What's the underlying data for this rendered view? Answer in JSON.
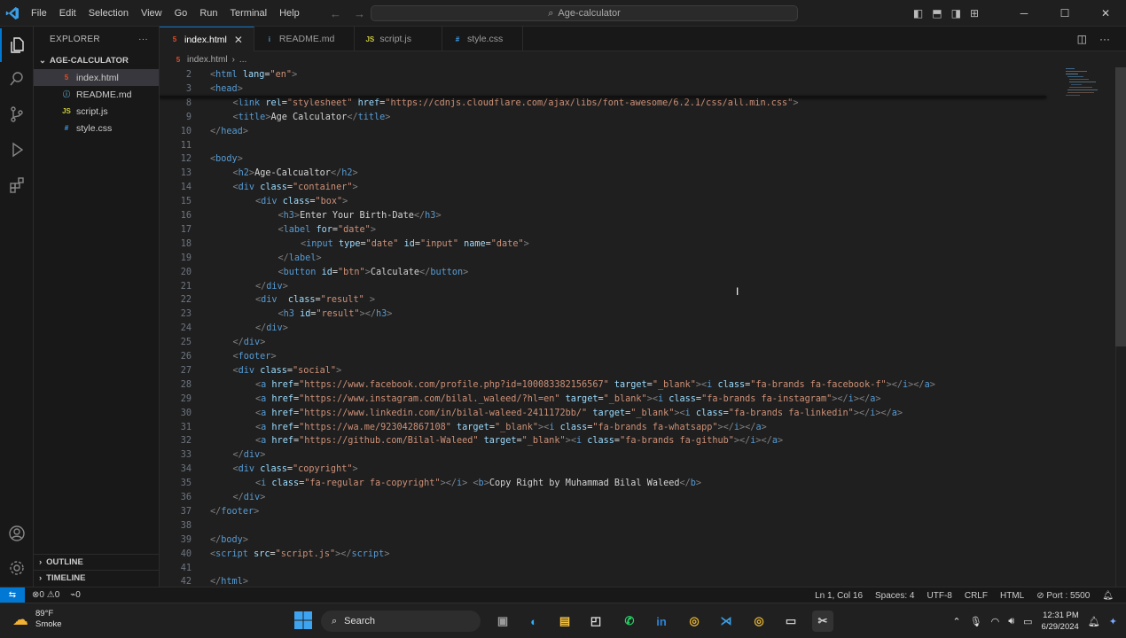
{
  "titlebar": {
    "menu": [
      "File",
      "Edit",
      "Selection",
      "View",
      "Go",
      "Run",
      "Terminal",
      "Help"
    ],
    "search_text": "Age-calculator"
  },
  "sidebar": {
    "title": "EXPLORER",
    "folder": "AGE-CALCULATOR",
    "files": [
      {
        "name": "index.html",
        "icon": "html-file-icon"
      },
      {
        "name": "README.md",
        "icon": "markdown-file-icon"
      },
      {
        "name": "script.js",
        "icon": "js-file-icon"
      },
      {
        "name": "style.css",
        "icon": "css-file-icon"
      }
    ],
    "outline": "OUTLINE",
    "timeline": "TIMELINE"
  },
  "tabs": [
    {
      "label": "index.html",
      "badge": "5"
    },
    {
      "label": "README.md",
      "badge": "i"
    },
    {
      "label": "script.js",
      "badge": "JS"
    },
    {
      "label": "style.css",
      "badge": "#"
    }
  ],
  "breadcrumb": {
    "file": "index.html",
    "rest": "..."
  },
  "code_lines": [
    {
      "n": "2",
      "indent": 0,
      "parts": [
        [
          "p",
          "<"
        ],
        [
          "t",
          "html"
        ],
        [
          "x",
          " "
        ],
        [
          "a",
          "lang"
        ],
        [
          "x",
          "="
        ],
        [
          "s",
          "\"en\""
        ],
        [
          "p",
          ">"
        ]
      ]
    },
    {
      "n": "3",
      "indent": 0,
      "parts": [
        [
          "p",
          "<"
        ],
        [
          "t",
          "head"
        ],
        [
          "p",
          ">"
        ]
      ]
    },
    {
      "n": "8",
      "indent": 1,
      "parts": [
        [
          "p",
          "<"
        ],
        [
          "t",
          "link"
        ],
        [
          "x",
          " "
        ],
        [
          "a",
          "rel"
        ],
        [
          "x",
          "="
        ],
        [
          "s",
          "\"stylesheet\""
        ],
        [
          "x",
          " "
        ],
        [
          "a",
          "href"
        ],
        [
          "x",
          "="
        ],
        [
          "s",
          "\"https://cdnjs.cloudflare.com/ajax/libs/font-awesome/6.2.1/css/all.min.css\""
        ],
        [
          "p",
          ">"
        ]
      ]
    },
    {
      "n": "9",
      "indent": 1,
      "parts": [
        [
          "p",
          "<"
        ],
        [
          "t",
          "title"
        ],
        [
          "p",
          ">"
        ],
        [
          "x",
          "Age Calculator"
        ],
        [
          "p",
          "</"
        ],
        [
          "t",
          "title"
        ],
        [
          "p",
          ">"
        ]
      ]
    },
    {
      "n": "10",
      "indent": 0,
      "parts": [
        [
          "p",
          "</"
        ],
        [
          "t",
          "head"
        ],
        [
          "p",
          ">"
        ]
      ]
    },
    {
      "n": "11",
      "indent": 0,
      "parts": []
    },
    {
      "n": "12",
      "indent": 0,
      "parts": [
        [
          "p",
          "<"
        ],
        [
          "t",
          "body"
        ],
        [
          "p",
          ">"
        ]
      ]
    },
    {
      "n": "13",
      "indent": 1,
      "parts": [
        [
          "p",
          "<"
        ],
        [
          "t",
          "h2"
        ],
        [
          "p",
          ">"
        ],
        [
          "x",
          "Age-Calcualtor"
        ],
        [
          "p",
          "</"
        ],
        [
          "t",
          "h2"
        ],
        [
          "p",
          ">"
        ]
      ]
    },
    {
      "n": "14",
      "indent": 1,
      "parts": [
        [
          "p",
          "<"
        ],
        [
          "t",
          "div"
        ],
        [
          "x",
          " "
        ],
        [
          "a",
          "class"
        ],
        [
          "x",
          "="
        ],
        [
          "s",
          "\"container\""
        ],
        [
          "p",
          ">"
        ]
      ]
    },
    {
      "n": "15",
      "indent": 2,
      "parts": [
        [
          "p",
          "<"
        ],
        [
          "t",
          "div"
        ],
        [
          "x",
          " "
        ],
        [
          "a",
          "class"
        ],
        [
          "x",
          "="
        ],
        [
          "s",
          "\"box\""
        ],
        [
          "p",
          ">"
        ]
      ]
    },
    {
      "n": "16",
      "indent": 3,
      "parts": [
        [
          "p",
          "<"
        ],
        [
          "t",
          "h3"
        ],
        [
          "p",
          ">"
        ],
        [
          "x",
          "Enter Your Birth-Date"
        ],
        [
          "p",
          "</"
        ],
        [
          "t",
          "h3"
        ],
        [
          "p",
          ">"
        ]
      ]
    },
    {
      "n": "17",
      "indent": 3,
      "parts": [
        [
          "p",
          "<"
        ],
        [
          "t",
          "label"
        ],
        [
          "x",
          " "
        ],
        [
          "a",
          "for"
        ],
        [
          "x",
          "="
        ],
        [
          "s",
          "\"date\""
        ],
        [
          "p",
          ">"
        ]
      ]
    },
    {
      "n": "18",
      "indent": 4,
      "parts": [
        [
          "p",
          "<"
        ],
        [
          "t",
          "input"
        ],
        [
          "x",
          " "
        ],
        [
          "a",
          "type"
        ],
        [
          "x",
          "="
        ],
        [
          "s",
          "\"date\""
        ],
        [
          "x",
          " "
        ],
        [
          "a",
          "id"
        ],
        [
          "x",
          "="
        ],
        [
          "s",
          "\"input\""
        ],
        [
          "x",
          " "
        ],
        [
          "a",
          "name"
        ],
        [
          "x",
          "="
        ],
        [
          "s",
          "\"date\""
        ],
        [
          "p",
          ">"
        ]
      ]
    },
    {
      "n": "19",
      "indent": 3,
      "parts": [
        [
          "p",
          "</"
        ],
        [
          "t",
          "label"
        ],
        [
          "p",
          ">"
        ]
      ]
    },
    {
      "n": "20",
      "indent": 3,
      "parts": [
        [
          "p",
          "<"
        ],
        [
          "t",
          "button"
        ],
        [
          "x",
          " "
        ],
        [
          "a",
          "id"
        ],
        [
          "x",
          "="
        ],
        [
          "s",
          "\"btn\""
        ],
        [
          "p",
          ">"
        ],
        [
          "x",
          "Calculate"
        ],
        [
          "p",
          "</"
        ],
        [
          "t",
          "button"
        ],
        [
          "p",
          ">"
        ]
      ]
    },
    {
      "n": "21",
      "indent": 2,
      "parts": [
        [
          "p",
          "</"
        ],
        [
          "t",
          "div"
        ],
        [
          "p",
          ">"
        ]
      ]
    },
    {
      "n": "22",
      "indent": 2,
      "parts": [
        [
          "p",
          "<"
        ],
        [
          "t",
          "div"
        ],
        [
          "x",
          "  "
        ],
        [
          "a",
          "class"
        ],
        [
          "x",
          "="
        ],
        [
          "s",
          "\"result\""
        ],
        [
          "x",
          " "
        ],
        [
          "p",
          ">"
        ]
      ]
    },
    {
      "n": "23",
      "indent": 3,
      "parts": [
        [
          "p",
          "<"
        ],
        [
          "t",
          "h3"
        ],
        [
          "x",
          " "
        ],
        [
          "a",
          "id"
        ],
        [
          "x",
          "="
        ],
        [
          "s",
          "\"result\""
        ],
        [
          "p",
          "></"
        ],
        [
          "t",
          "h3"
        ],
        [
          "p",
          ">"
        ]
      ]
    },
    {
      "n": "24",
      "indent": 2,
      "parts": [
        [
          "p",
          "</"
        ],
        [
          "t",
          "div"
        ],
        [
          "p",
          ">"
        ]
      ]
    },
    {
      "n": "25",
      "indent": 1,
      "parts": [
        [
          "p",
          "</"
        ],
        [
          "t",
          "div"
        ],
        [
          "p",
          ">"
        ]
      ]
    },
    {
      "n": "26",
      "indent": 1,
      "parts": [
        [
          "p",
          "<"
        ],
        [
          "t",
          "footer"
        ],
        [
          "p",
          ">"
        ]
      ]
    },
    {
      "n": "27",
      "indent": 1,
      "parts": [
        [
          "p",
          "<"
        ],
        [
          "t",
          "div"
        ],
        [
          "x",
          " "
        ],
        [
          "a",
          "class"
        ],
        [
          "x",
          "="
        ],
        [
          "s",
          "\"social\""
        ],
        [
          "p",
          ">"
        ]
      ]
    },
    {
      "n": "28",
      "indent": 2,
      "parts": [
        [
          "p",
          "<"
        ],
        [
          "t",
          "a"
        ],
        [
          "x",
          " "
        ],
        [
          "a",
          "href"
        ],
        [
          "x",
          "="
        ],
        [
          "s",
          "\"https://www.facebook.com/profile.php?id=100083382156567\""
        ],
        [
          "x",
          " "
        ],
        [
          "a",
          "target"
        ],
        [
          "x",
          "="
        ],
        [
          "s",
          "\"_blank\""
        ],
        [
          "p",
          "><"
        ],
        [
          "t",
          "i"
        ],
        [
          "x",
          " "
        ],
        [
          "a",
          "class"
        ],
        [
          "x",
          "="
        ],
        [
          "s",
          "\"fa-brands fa-facebook-f\""
        ],
        [
          "p",
          "></"
        ],
        [
          "t",
          "i"
        ],
        [
          "p",
          "></"
        ],
        [
          "t",
          "a"
        ],
        [
          "p",
          ">"
        ]
      ]
    },
    {
      "n": "29",
      "indent": 2,
      "parts": [
        [
          "p",
          "<"
        ],
        [
          "t",
          "a"
        ],
        [
          "x",
          " "
        ],
        [
          "a",
          "href"
        ],
        [
          "x",
          "="
        ],
        [
          "s",
          "\"https://www.instagram.com/bilal._waleed/?hl=en\""
        ],
        [
          "x",
          " "
        ],
        [
          "a",
          "target"
        ],
        [
          "x",
          "="
        ],
        [
          "s",
          "\"_blank\""
        ],
        [
          "p",
          "><"
        ],
        [
          "t",
          "i"
        ],
        [
          "x",
          " "
        ],
        [
          "a",
          "class"
        ],
        [
          "x",
          "="
        ],
        [
          "s",
          "\"fa-brands fa-instagram\""
        ],
        [
          "p",
          "></"
        ],
        [
          "t",
          "i"
        ],
        [
          "p",
          "></"
        ],
        [
          "t",
          "a"
        ],
        [
          "p",
          ">"
        ]
      ]
    },
    {
      "n": "30",
      "indent": 2,
      "parts": [
        [
          "p",
          "<"
        ],
        [
          "t",
          "a"
        ],
        [
          "x",
          " "
        ],
        [
          "a",
          "href"
        ],
        [
          "x",
          "="
        ],
        [
          "s",
          "\"https://www.linkedin.com/in/bilal-waleed-2411172bb/\""
        ],
        [
          "x",
          " "
        ],
        [
          "a",
          "target"
        ],
        [
          "x",
          "="
        ],
        [
          "s",
          "\"_blank\""
        ],
        [
          "p",
          "><"
        ],
        [
          "t",
          "i"
        ],
        [
          "x",
          " "
        ],
        [
          "a",
          "class"
        ],
        [
          "x",
          "="
        ],
        [
          "s",
          "\"fa-brands fa-linkedin\""
        ],
        [
          "p",
          "></"
        ],
        [
          "t",
          "i"
        ],
        [
          "p",
          "></"
        ],
        [
          "t",
          "a"
        ],
        [
          "p",
          ">"
        ]
      ]
    },
    {
      "n": "31",
      "indent": 2,
      "parts": [
        [
          "p",
          "<"
        ],
        [
          "t",
          "a"
        ],
        [
          "x",
          " "
        ],
        [
          "a",
          "href"
        ],
        [
          "x",
          "="
        ],
        [
          "s",
          "\"https://wa.me/923042867108\""
        ],
        [
          "x",
          " "
        ],
        [
          "a",
          "target"
        ],
        [
          "x",
          "="
        ],
        [
          "s",
          "\"_blank\""
        ],
        [
          "p",
          "><"
        ],
        [
          "t",
          "i"
        ],
        [
          "x",
          " "
        ],
        [
          "a",
          "class"
        ],
        [
          "x",
          "="
        ],
        [
          "s",
          "\"fa-brands fa-whatsapp\""
        ],
        [
          "p",
          "></"
        ],
        [
          "t",
          "i"
        ],
        [
          "p",
          "></"
        ],
        [
          "t",
          "a"
        ],
        [
          "p",
          ">"
        ]
      ]
    },
    {
      "n": "32",
      "indent": 2,
      "parts": [
        [
          "p",
          "<"
        ],
        [
          "t",
          "a"
        ],
        [
          "x",
          " "
        ],
        [
          "a",
          "href"
        ],
        [
          "x",
          "="
        ],
        [
          "s",
          "\"https://github.com/Bilal-Waleed\""
        ],
        [
          "x",
          " "
        ],
        [
          "a",
          "target"
        ],
        [
          "x",
          "="
        ],
        [
          "s",
          "\"_blank\""
        ],
        [
          "p",
          "><"
        ],
        [
          "t",
          "i"
        ],
        [
          "x",
          " "
        ],
        [
          "a",
          "class"
        ],
        [
          "x",
          "="
        ],
        [
          "s",
          "\"fa-brands fa-github\""
        ],
        [
          "p",
          "></"
        ],
        [
          "t",
          "i"
        ],
        [
          "p",
          "></"
        ],
        [
          "t",
          "a"
        ],
        [
          "p",
          ">"
        ]
      ]
    },
    {
      "n": "33",
      "indent": 1,
      "parts": [
        [
          "p",
          "</"
        ],
        [
          "t",
          "div"
        ],
        [
          "p",
          ">"
        ]
      ]
    },
    {
      "n": "34",
      "indent": 1,
      "parts": [
        [
          "p",
          "<"
        ],
        [
          "t",
          "div"
        ],
        [
          "x",
          " "
        ],
        [
          "a",
          "class"
        ],
        [
          "x",
          "="
        ],
        [
          "s",
          "\"copyright\""
        ],
        [
          "p",
          ">"
        ]
      ]
    },
    {
      "n": "35",
      "indent": 2,
      "parts": [
        [
          "p",
          "<"
        ],
        [
          "t",
          "i"
        ],
        [
          "x",
          " "
        ],
        [
          "a",
          "class"
        ],
        [
          "x",
          "="
        ],
        [
          "s",
          "\"fa-regular fa-copyright\""
        ],
        [
          "p",
          "></"
        ],
        [
          "t",
          "i"
        ],
        [
          "p",
          ">"
        ],
        [
          "x",
          " "
        ],
        [
          "p",
          "<"
        ],
        [
          "t",
          "b"
        ],
        [
          "p",
          ">"
        ],
        [
          "x",
          "Copy Right by Muhammad Bilal Waleed"
        ],
        [
          "p",
          "</"
        ],
        [
          "t",
          "b"
        ],
        [
          "p",
          ">"
        ]
      ]
    },
    {
      "n": "36",
      "indent": 1,
      "parts": [
        [
          "p",
          "</"
        ],
        [
          "t",
          "div"
        ],
        [
          "p",
          ">"
        ]
      ]
    },
    {
      "n": "37",
      "indent": 0,
      "parts": [
        [
          "p",
          "</"
        ],
        [
          "t",
          "footer"
        ],
        [
          "p",
          ">"
        ]
      ]
    },
    {
      "n": "38",
      "indent": 0,
      "parts": []
    },
    {
      "n": "39",
      "indent": 0,
      "parts": [
        [
          "p",
          "</"
        ],
        [
          "t",
          "body"
        ],
        [
          "p",
          ">"
        ]
      ]
    },
    {
      "n": "40",
      "indent": 0,
      "parts": [
        [
          "p",
          "<"
        ],
        [
          "t",
          "script"
        ],
        [
          "x",
          " "
        ],
        [
          "a",
          "src"
        ],
        [
          "x",
          "="
        ],
        [
          "s",
          "\"script.js\""
        ],
        [
          "p",
          "></"
        ],
        [
          "t",
          "script"
        ],
        [
          "p",
          ">"
        ]
      ]
    },
    {
      "n": "41",
      "indent": 0,
      "parts": []
    },
    {
      "n": "42",
      "indent": 0,
      "parts": [
        [
          "p",
          "</"
        ],
        [
          "t",
          "html"
        ],
        [
          "p",
          ">"
        ]
      ]
    }
  ],
  "statusbar": {
    "errors": "0",
    "warnings": "0",
    "ports": "0",
    "position": "Ln 1, Col 16",
    "spaces": "Spaces: 4",
    "encoding": "UTF-8",
    "eol": "CRLF",
    "language": "HTML",
    "port": "Port : 5500"
  },
  "taskbar": {
    "temp": "89°F",
    "weather": "Smoke",
    "search": "Search",
    "time": "12:31 PM",
    "date": "6/29/2024"
  },
  "colors": {
    "accent": "#0078d4",
    "tag": "#569cd6",
    "attr": "#9cdcfe",
    "string": "#ce9178"
  }
}
